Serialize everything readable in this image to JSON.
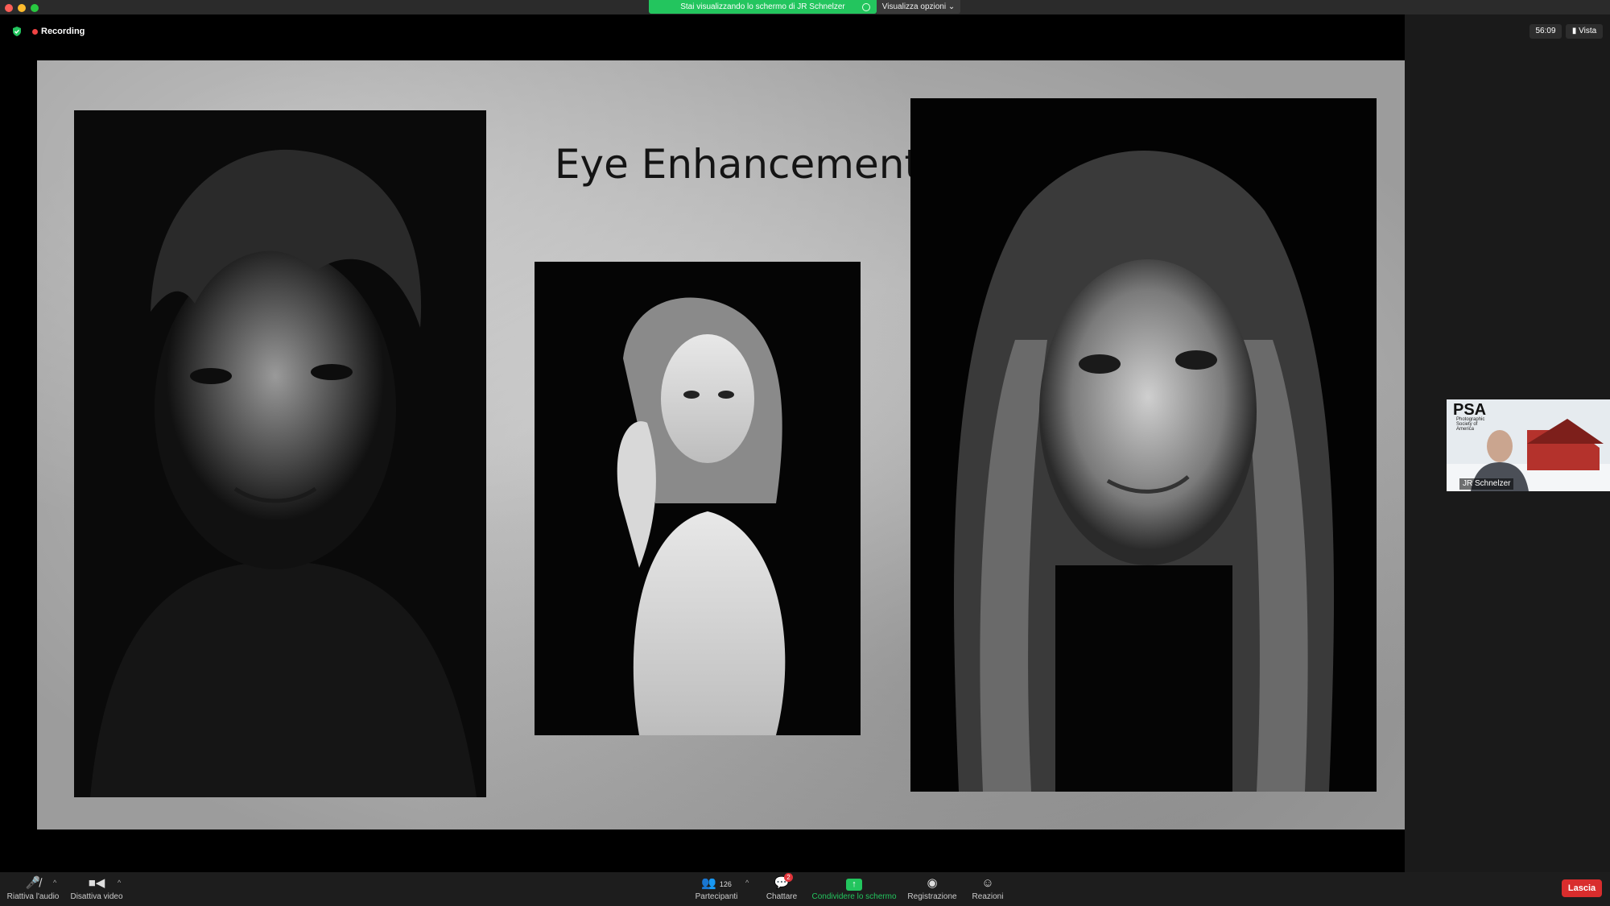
{
  "window": {
    "share_banner": "Stai visualizzando lo schermo di JR Schnelzer",
    "view_options": "Visualizza opzioni ⌄"
  },
  "meeting": {
    "recording_label": "Recording",
    "timer": "56:09",
    "view_button": "Vista"
  },
  "slide": {
    "title": "Eye Enhancement"
  },
  "participant": {
    "name": "JR Schnelzer",
    "logo_text": "PSA",
    "logo_subtitle": "Photographic Society of America"
  },
  "toolbar": {
    "unmute": "Riattiva l'audio",
    "stop_video": "Disattiva video",
    "participants": "Partecipanti",
    "participants_count": "126",
    "chat": "Chattare",
    "chat_badge": "2",
    "share": "Condividere lo schermo",
    "record": "Registrazione",
    "reactions": "Reazioni",
    "leave": "Lascia"
  },
  "colors": {
    "share_green": "#23c55e",
    "leave_red": "#d92d2d",
    "record_dot": "#f04343"
  }
}
